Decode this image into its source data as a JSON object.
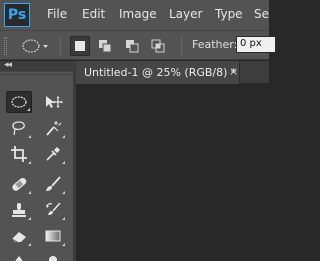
{
  "app": {
    "logo_text": "Ps"
  },
  "menu": {
    "items": [
      "File",
      "Edit",
      "Image",
      "Layer",
      "Type",
      "Se"
    ]
  },
  "options_bar": {
    "feather_label": "Feather:",
    "feather_value": "0 px"
  },
  "document": {
    "tab_title": "Untitled-1 @ 25% (RGB/8) *",
    "close_glyph": "×"
  },
  "toolbar": {
    "collapse_glyph": "◂◂",
    "tools": [
      "rectangular-marquee",
      "move",
      "lasso",
      "magic-wand",
      "crop",
      "eyedropper",
      "spot-healing-brush",
      "brush",
      "clone-stamp",
      "history-brush",
      "eraser",
      "gradient",
      "blur",
      "dodge"
    ]
  },
  "colors": {
    "chrome": "#535353",
    "canvas": "#282828",
    "accent": "#31a8ff"
  }
}
